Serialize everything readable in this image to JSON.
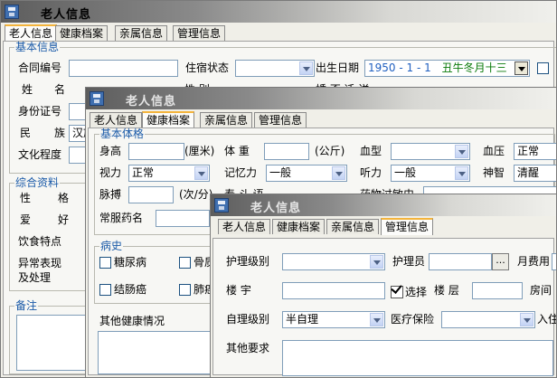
{
  "tabs": [
    "老人信息",
    "健康档案",
    "亲属信息",
    "管理信息"
  ],
  "win1": {
    "title": "老人信息",
    "basic_legend": "基本信息",
    "labels": {
      "contract_no": "合同编号",
      "residence_status": "住宿状态",
      "birth_date": "出生日期",
      "name_a": "姓",
      "name_b": "名",
      "id_no": "身份证号",
      "ethnicity_a": "民",
      "ethnicity_b": "族",
      "education": "文化程度",
      "gender_partial": "性    别",
      "marital_partial": "婚 否 迁 送"
    },
    "values": {
      "birth_date": "1950 - 1  - 1",
      "lunar_date": "丑牛冬月十三",
      "ethnicity": "汉族"
    },
    "general_legend": "综合资料",
    "general_labels": {
      "personality_a": "性",
      "personality_b": "格",
      "hobby_a": "爱",
      "hobby_b": "好",
      "diet": "饮食特点",
      "abnormal_line1": "异常表现",
      "abnormal_line2": "及处理"
    },
    "remarks_legend": "备注"
  },
  "win2": {
    "title": "老人信息",
    "vitals_legend": "基本体格",
    "labels": {
      "height": "身高",
      "height_unit": "(厘米)",
      "weight": "体  重",
      "weight_unit": "(公斤)",
      "blood_type": "血型",
      "blood_pressure": "血压",
      "vision": "视力",
      "memory": "记忆力",
      "hearing": "听力",
      "mind": "神智",
      "pulse": "脉搏",
      "pulse_unit": "(次/分)",
      "medication": "常服药名",
      "partial_label": "寿 斗 语",
      "allergy": "药物过敏史"
    },
    "values": {
      "blood_pressure": "正常",
      "vision": "正常",
      "memory": "一般",
      "hearing": "一般",
      "mind": "清醒"
    },
    "history_legend": "病史",
    "history_items": [
      "糖尿病",
      "骨质",
      "结肠癌",
      "肺癌"
    ],
    "other_health": "其他健康情况"
  },
  "win3": {
    "title": "老人信息",
    "labels": {
      "care_level": "护理级别",
      "caregiver": "护理员",
      "monthly_fee": "月费用",
      "building": "楼  宇",
      "select": "选择",
      "floor": "楼  层",
      "room_partial": "房间",
      "self_care": "自理级别",
      "medical_insurance": "医疗保险",
      "checkin_partial": "入住",
      "other_requirements": "其他要求"
    },
    "values": {
      "self_care": "半自理",
      "dots": "..."
    }
  },
  "colors": {
    "tab_highlight": "#f4b43c",
    "legend_text": "#1a5aa8",
    "lunar_text": "#0a7a0a",
    "date_text": "#2060c0"
  }
}
